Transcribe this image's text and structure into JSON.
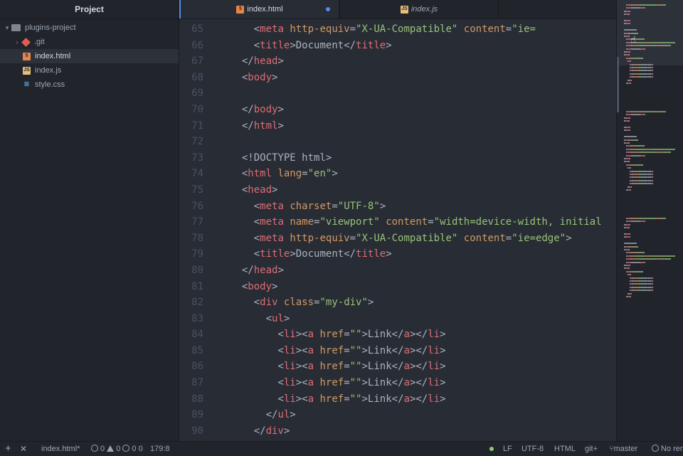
{
  "sidebar": {
    "title": "Project",
    "tree": [
      {
        "label": "plugins-project",
        "icon": "folder-icon"
      },
      {
        "label": ".git",
        "icon": "git-icon"
      },
      {
        "label": "index.html",
        "icon": "html-file-icon"
      },
      {
        "label": "index.js",
        "icon": "js-file-icon"
      },
      {
        "label": "style.css",
        "icon": "css-file-icon"
      }
    ]
  },
  "tabs": [
    {
      "label": "index.html",
      "icon": "html-file-icon",
      "modified": true
    },
    {
      "label": "index.js",
      "icon": "js-file-icon"
    }
  ],
  "editor": {
    "lines": [
      {
        "n": "65",
        "t": [
          [
            "",
            "    "
          ],
          [
            "pn",
            "<"
          ],
          [
            "tg",
            "meta"
          ],
          [
            "",
            " "
          ],
          [
            "at",
            "http-equiv"
          ],
          [
            "pn",
            "="
          ],
          [
            "st",
            "\"X-UA-Compatible\""
          ],
          [
            "",
            " "
          ],
          [
            "at",
            "content"
          ],
          [
            "pn",
            "="
          ],
          [
            "st",
            "\"ie="
          ]
        ]
      },
      {
        "n": "66",
        "t": [
          [
            "",
            "    "
          ],
          [
            "pn",
            "<"
          ],
          [
            "tg",
            "title"
          ],
          [
            "pn",
            ">"
          ],
          [
            "",
            "Document"
          ],
          [
            "pn",
            "</"
          ],
          [
            "tg",
            "title"
          ],
          [
            "pn",
            ">"
          ]
        ]
      },
      {
        "n": "67",
        "t": [
          [
            "",
            "  "
          ],
          [
            "pn",
            "</"
          ],
          [
            "tg",
            "head"
          ],
          [
            "pn",
            ">"
          ]
        ]
      },
      {
        "n": "68",
        "t": [
          [
            "",
            "  "
          ],
          [
            "pn",
            "<"
          ],
          [
            "tg",
            "body"
          ],
          [
            "pn",
            ">"
          ]
        ]
      },
      {
        "n": "69",
        "t": [
          [
            "",
            ""
          ]
        ]
      },
      {
        "n": "70",
        "t": [
          [
            "",
            "  "
          ],
          [
            "pn",
            "</"
          ],
          [
            "tg",
            "body"
          ],
          [
            "pn",
            ">"
          ]
        ]
      },
      {
        "n": "71",
        "t": [
          [
            "",
            "  "
          ],
          [
            "pn",
            "</"
          ],
          [
            "tg",
            "html"
          ],
          [
            "pn",
            ">"
          ]
        ]
      },
      {
        "n": "72",
        "t": [
          [
            "",
            ""
          ]
        ]
      },
      {
        "n": "73",
        "t": [
          [
            "",
            "  "
          ],
          [
            "pn",
            "<!DOCTYPE html>"
          ]
        ]
      },
      {
        "n": "74",
        "t": [
          [
            "",
            "  "
          ],
          [
            "pn",
            "<"
          ],
          [
            "tg",
            "html"
          ],
          [
            "",
            " "
          ],
          [
            "at",
            "lang"
          ],
          [
            "pn",
            "="
          ],
          [
            "st",
            "\"en\""
          ],
          [
            "pn",
            ">"
          ]
        ]
      },
      {
        "n": "75",
        "t": [
          [
            "",
            "  "
          ],
          [
            "pn",
            "<"
          ],
          [
            "tg",
            "head"
          ],
          [
            "pn",
            ">"
          ]
        ]
      },
      {
        "n": "76",
        "t": [
          [
            "",
            "    "
          ],
          [
            "pn",
            "<"
          ],
          [
            "tg",
            "meta"
          ],
          [
            "",
            " "
          ],
          [
            "at",
            "charset"
          ],
          [
            "pn",
            "="
          ],
          [
            "st",
            "\"UTF-8\""
          ],
          [
            "pn",
            ">"
          ]
        ]
      },
      {
        "n": "77",
        "t": [
          [
            "",
            "    "
          ],
          [
            "pn",
            "<"
          ],
          [
            "tg",
            "meta"
          ],
          [
            "",
            " "
          ],
          [
            "at",
            "name"
          ],
          [
            "pn",
            "="
          ],
          [
            "st",
            "\"viewport\""
          ],
          [
            "",
            " "
          ],
          [
            "at",
            "content"
          ],
          [
            "pn",
            "="
          ],
          [
            "st",
            "\"width=device-width, initial"
          ]
        ]
      },
      {
        "n": "78",
        "t": [
          [
            "",
            "    "
          ],
          [
            "pn",
            "<"
          ],
          [
            "tg",
            "meta"
          ],
          [
            "",
            " "
          ],
          [
            "at",
            "http-equiv"
          ],
          [
            "pn",
            "="
          ],
          [
            "st",
            "\"X-UA-Compatible\""
          ],
          [
            "",
            " "
          ],
          [
            "at",
            "content"
          ],
          [
            "pn",
            "="
          ],
          [
            "st",
            "\"ie=edge\""
          ],
          [
            "pn",
            ">"
          ]
        ]
      },
      {
        "n": "79",
        "t": [
          [
            "",
            "    "
          ],
          [
            "pn",
            "<"
          ],
          [
            "tg",
            "title"
          ],
          [
            "pn",
            ">"
          ],
          [
            "",
            "Document"
          ],
          [
            "pn",
            "</"
          ],
          [
            "tg",
            "title"
          ],
          [
            "pn",
            ">"
          ]
        ]
      },
      {
        "n": "80",
        "t": [
          [
            "",
            "  "
          ],
          [
            "pn",
            "</"
          ],
          [
            "tg",
            "head"
          ],
          [
            "pn",
            ">"
          ]
        ]
      },
      {
        "n": "81",
        "t": [
          [
            "",
            "  "
          ],
          [
            "pn",
            "<"
          ],
          [
            "tg",
            "body"
          ],
          [
            "pn",
            ">"
          ]
        ]
      },
      {
        "n": "82",
        "t": [
          [
            "",
            "    "
          ],
          [
            "pn",
            "<"
          ],
          [
            "tg",
            "div"
          ],
          [
            "",
            " "
          ],
          [
            "at",
            "class"
          ],
          [
            "pn",
            "="
          ],
          [
            "st",
            "\"my-div\""
          ],
          [
            "pn",
            ">"
          ]
        ]
      },
      {
        "n": "83",
        "t": [
          [
            "",
            "      "
          ],
          [
            "pn",
            "<"
          ],
          [
            "tg",
            "ul"
          ],
          [
            "pn",
            ">"
          ]
        ]
      },
      {
        "n": "84",
        "t": [
          [
            "",
            "        "
          ],
          [
            "pn",
            "<"
          ],
          [
            "tg",
            "li"
          ],
          [
            "pn",
            "><"
          ],
          [
            "tg",
            "a"
          ],
          [
            "",
            " "
          ],
          [
            "at",
            "href"
          ],
          [
            "pn",
            "="
          ],
          [
            "st",
            "\"\""
          ],
          [
            "pn",
            ">"
          ],
          [
            "",
            "Link"
          ],
          [
            "pn",
            "</"
          ],
          [
            "tg",
            "a"
          ],
          [
            "pn",
            "></"
          ],
          [
            "tg",
            "li"
          ],
          [
            "pn",
            ">"
          ]
        ]
      },
      {
        "n": "85",
        "t": [
          [
            "",
            "        "
          ],
          [
            "pn",
            "<"
          ],
          [
            "tg",
            "li"
          ],
          [
            "pn",
            "><"
          ],
          [
            "tg",
            "a"
          ],
          [
            "",
            " "
          ],
          [
            "at",
            "href"
          ],
          [
            "pn",
            "="
          ],
          [
            "st",
            "\"\""
          ],
          [
            "pn",
            ">"
          ],
          [
            "",
            "Link"
          ],
          [
            "pn",
            "</"
          ],
          [
            "tg",
            "a"
          ],
          [
            "pn",
            "></"
          ],
          [
            "tg",
            "li"
          ],
          [
            "pn",
            ">"
          ]
        ]
      },
      {
        "n": "86",
        "t": [
          [
            "",
            "        "
          ],
          [
            "pn",
            "<"
          ],
          [
            "tg",
            "li"
          ],
          [
            "pn",
            "><"
          ],
          [
            "tg",
            "a"
          ],
          [
            "",
            " "
          ],
          [
            "at",
            "href"
          ],
          [
            "pn",
            "="
          ],
          [
            "st",
            "\"\""
          ],
          [
            "pn",
            ">"
          ],
          [
            "",
            "Link"
          ],
          [
            "pn",
            "</"
          ],
          [
            "tg",
            "a"
          ],
          [
            "pn",
            "></"
          ],
          [
            "tg",
            "li"
          ],
          [
            "pn",
            ">"
          ]
        ]
      },
      {
        "n": "87",
        "t": [
          [
            "",
            "        "
          ],
          [
            "pn",
            "<"
          ],
          [
            "tg",
            "li"
          ],
          [
            "pn",
            "><"
          ],
          [
            "tg",
            "a"
          ],
          [
            "",
            " "
          ],
          [
            "at",
            "href"
          ],
          [
            "pn",
            "="
          ],
          [
            "st",
            "\"\""
          ],
          [
            "pn",
            ">"
          ],
          [
            "",
            "Link"
          ],
          [
            "pn",
            "</"
          ],
          [
            "tg",
            "a"
          ],
          [
            "pn",
            "></"
          ],
          [
            "tg",
            "li"
          ],
          [
            "pn",
            ">"
          ]
        ]
      },
      {
        "n": "88",
        "t": [
          [
            "",
            "        "
          ],
          [
            "pn",
            "<"
          ],
          [
            "tg",
            "li"
          ],
          [
            "pn",
            "><"
          ],
          [
            "tg",
            "a"
          ],
          [
            "",
            " "
          ],
          [
            "at",
            "href"
          ],
          [
            "pn",
            "="
          ],
          [
            "st",
            "\"\""
          ],
          [
            "pn",
            ">"
          ],
          [
            "",
            "Link"
          ],
          [
            "pn",
            "</"
          ],
          [
            "tg",
            "a"
          ],
          [
            "pn",
            "></"
          ],
          [
            "tg",
            "li"
          ],
          [
            "pn",
            ">"
          ]
        ]
      },
      {
        "n": "89",
        "t": [
          [
            "",
            "      "
          ],
          [
            "pn",
            "</"
          ],
          [
            "tg",
            "ul"
          ],
          [
            "pn",
            ">"
          ]
        ]
      },
      {
        "n": "90",
        "t": [
          [
            "",
            "    "
          ],
          [
            "pn",
            "</"
          ],
          [
            "tg",
            "div"
          ],
          [
            "pn",
            ">"
          ]
        ]
      }
    ]
  },
  "statusbar": {
    "add_label": "+",
    "close_label": "✕",
    "file_label": "index.html*",
    "errors": "0",
    "warnings": "0",
    "infos": "0",
    "info_value": "0",
    "cursor": "179:8",
    "line_ending": "LF",
    "encoding": "UTF-8",
    "grammar": "HTML",
    "git_label": "git+",
    "branch": "master",
    "no_render": "No ren"
  },
  "colors": {
    "tag": "#e06c75",
    "attribute": "#d19a66",
    "string": "#98c379",
    "text": "#abb2bf",
    "accent": "#568af2"
  }
}
